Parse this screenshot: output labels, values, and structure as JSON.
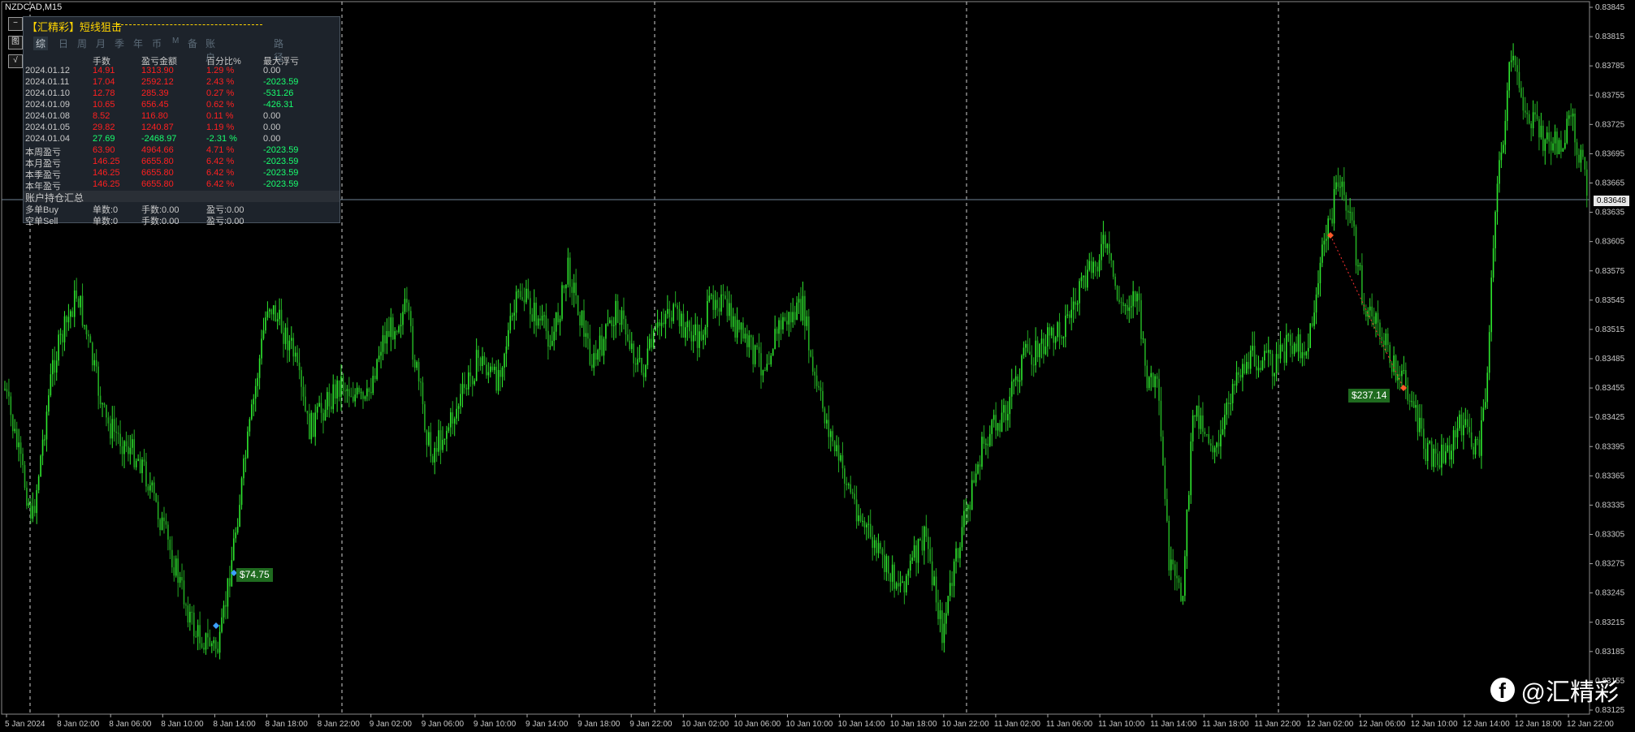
{
  "symbol": "NZDCAD,M15",
  "current_price": "0.83648",
  "price_axis": [
    "0.83845",
    "0.83815",
    "0.83785",
    "0.83755",
    "0.83725",
    "0.83695",
    "0.83665",
    "0.83635",
    "0.83605",
    "0.83575",
    "0.83545",
    "0.83515",
    "0.83485",
    "0.83455",
    "0.83425",
    "0.83395",
    "0.83365",
    "0.83335",
    "0.83305",
    "0.83275",
    "0.83245",
    "0.83215",
    "0.83185",
    "0.83155",
    "0.83125"
  ],
  "time_axis": [
    "5 Jan 2024",
    "8 Jan 02:00",
    "8 Jan 06:00",
    "8 Jan 10:00",
    "8 Jan 14:00",
    "8 Jan 18:00",
    "8 Jan 22:00",
    "9 Jan 02:00",
    "9 Jan 06:00",
    "9 Jan 10:00",
    "9 Jan 14:00",
    "9 Jan 18:00",
    "9 Jan 22:00",
    "10 Jan 02:00",
    "10 Jan 06:00",
    "10 Jan 10:00",
    "10 Jan 14:00",
    "10 Jan 18:00",
    "10 Jan 22:00",
    "11 Jan 02:00",
    "11 Jan 06:00",
    "11 Jan 10:00",
    "11 Jan 14:00",
    "11 Jan 18:00",
    "11 Jan 22:00",
    "12 Jan 02:00",
    "12 Jan 06:00",
    "12 Jan 10:00",
    "12 Jan 14:00",
    "12 Jan 18:00",
    "12 Jan 22:00"
  ],
  "side_buttons": [
    "−",
    "图",
    "√"
  ],
  "panel": {
    "title": "【汇精彩】短线狙击",
    "tabs": [
      "综",
      "日",
      "周",
      "月",
      "季",
      "年",
      "币",
      "M",
      "备",
      "账户",
      "路径"
    ],
    "headers": [
      "手数",
      "盈亏金额",
      "百分比%",
      "最大浮亏"
    ],
    "rows": [
      {
        "label": "2024.01.12",
        "lots": "14.91",
        "profit": "1313.90",
        "pct": "1.29 %",
        "dd": "0.00"
      },
      {
        "label": "2024.01.11",
        "lots": "17.04",
        "profit": "2592.12",
        "pct": "2.43 %",
        "dd": "-2023.59"
      },
      {
        "label": "2024.01.10",
        "lots": "12.78",
        "profit": "285.39",
        "pct": "0.27 %",
        "dd": "-531.26"
      },
      {
        "label": "2024.01.09",
        "lots": "10.65",
        "profit": "656.45",
        "pct": "0.62 %",
        "dd": "-426.31"
      },
      {
        "label": "2024.01.08",
        "lots": "8.52",
        "profit": "116.80",
        "pct": "0.11 %",
        "dd": "0.00"
      },
      {
        "label": "2024.01.05",
        "lots": "29.82",
        "profit": "1240.87",
        "pct": "1.19 %",
        "dd": "0.00"
      },
      {
        "label": "2024.01.04",
        "lots": "27.69",
        "profit": "-2468.97",
        "pct": "-2.31 %",
        "dd": "0.00"
      },
      {
        "label": "本周盈亏",
        "lots": "63.90",
        "profit": "4964.66",
        "pct": "4.71 %",
        "dd": "-2023.59"
      },
      {
        "label": "本月盈亏",
        "lots": "146.25",
        "profit": "6655.80",
        "pct": "6.42 %",
        "dd": "-2023.59"
      },
      {
        "label": "本季盈亏",
        "lots": "146.25",
        "profit": "6655.80",
        "pct": "6.42 %",
        "dd": "-2023.59"
      },
      {
        "label": "本年盈亏",
        "lots": "146.25",
        "profit": "6655.80",
        "pct": "6.42 %",
        "dd": "-2023.59"
      }
    ],
    "summary_title": "账户持仓汇总",
    "positions": [
      {
        "label": "多单Buy",
        "count": "单数:0",
        "lots": "手数:0.00",
        "profit": "盈亏:0.00"
      },
      {
        "label": "空单Sell",
        "count": "单数:0",
        "lots": "手数:0.00",
        "profit": "盈亏:0.00"
      }
    ]
  },
  "trade_labels": [
    "$74.75",
    "$237.14"
  ],
  "brand": {
    "icon": "facebook-icon",
    "text": "@汇精彩"
  },
  "colors": {
    "bull": "#2ee62e",
    "bear": "#22aa22",
    "accent": "#ffd400",
    "profit": "#ff2020",
    "loss": "#18ff6e"
  }
}
